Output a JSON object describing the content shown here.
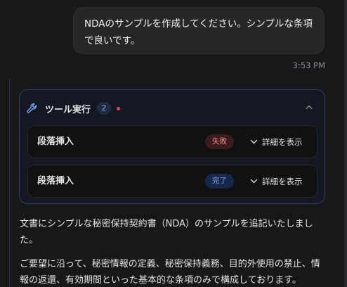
{
  "user_message": {
    "line1": "NDAのサンプルを作成してください。シンプルな条項",
    "line2": "で良いです。",
    "time": "3:53 PM"
  },
  "tool_panel": {
    "title": "ツール実行",
    "count": "2",
    "steps": [
      {
        "label": "段落挿入",
        "status": "失敗",
        "details": "詳細を表示"
      },
      {
        "label": "段落挿入",
        "status": "完了",
        "details": "詳細を表示"
      }
    ]
  },
  "response": {
    "p1": "文書にシンプルな秘密保持契約書（NDA）のサンプルを追記いたしまし",
    "p1b": "た。",
    "p2": "ご要望に沿って、秘密情報の定義、秘密保持義務、目的外使用の禁止、情",
    "p2b": "報の返還、有効期間といった基本的な条項のみで構成しております。"
  },
  "colors": {
    "background": "#18181b",
    "panel_border": "#2c3e6a",
    "failed": "#f08a8a",
    "done": "#7ca3f0",
    "accent": "#7aa2f7"
  },
  "icons": [
    "wrench-icon",
    "chevron-up-icon",
    "chevron-down-icon"
  ]
}
